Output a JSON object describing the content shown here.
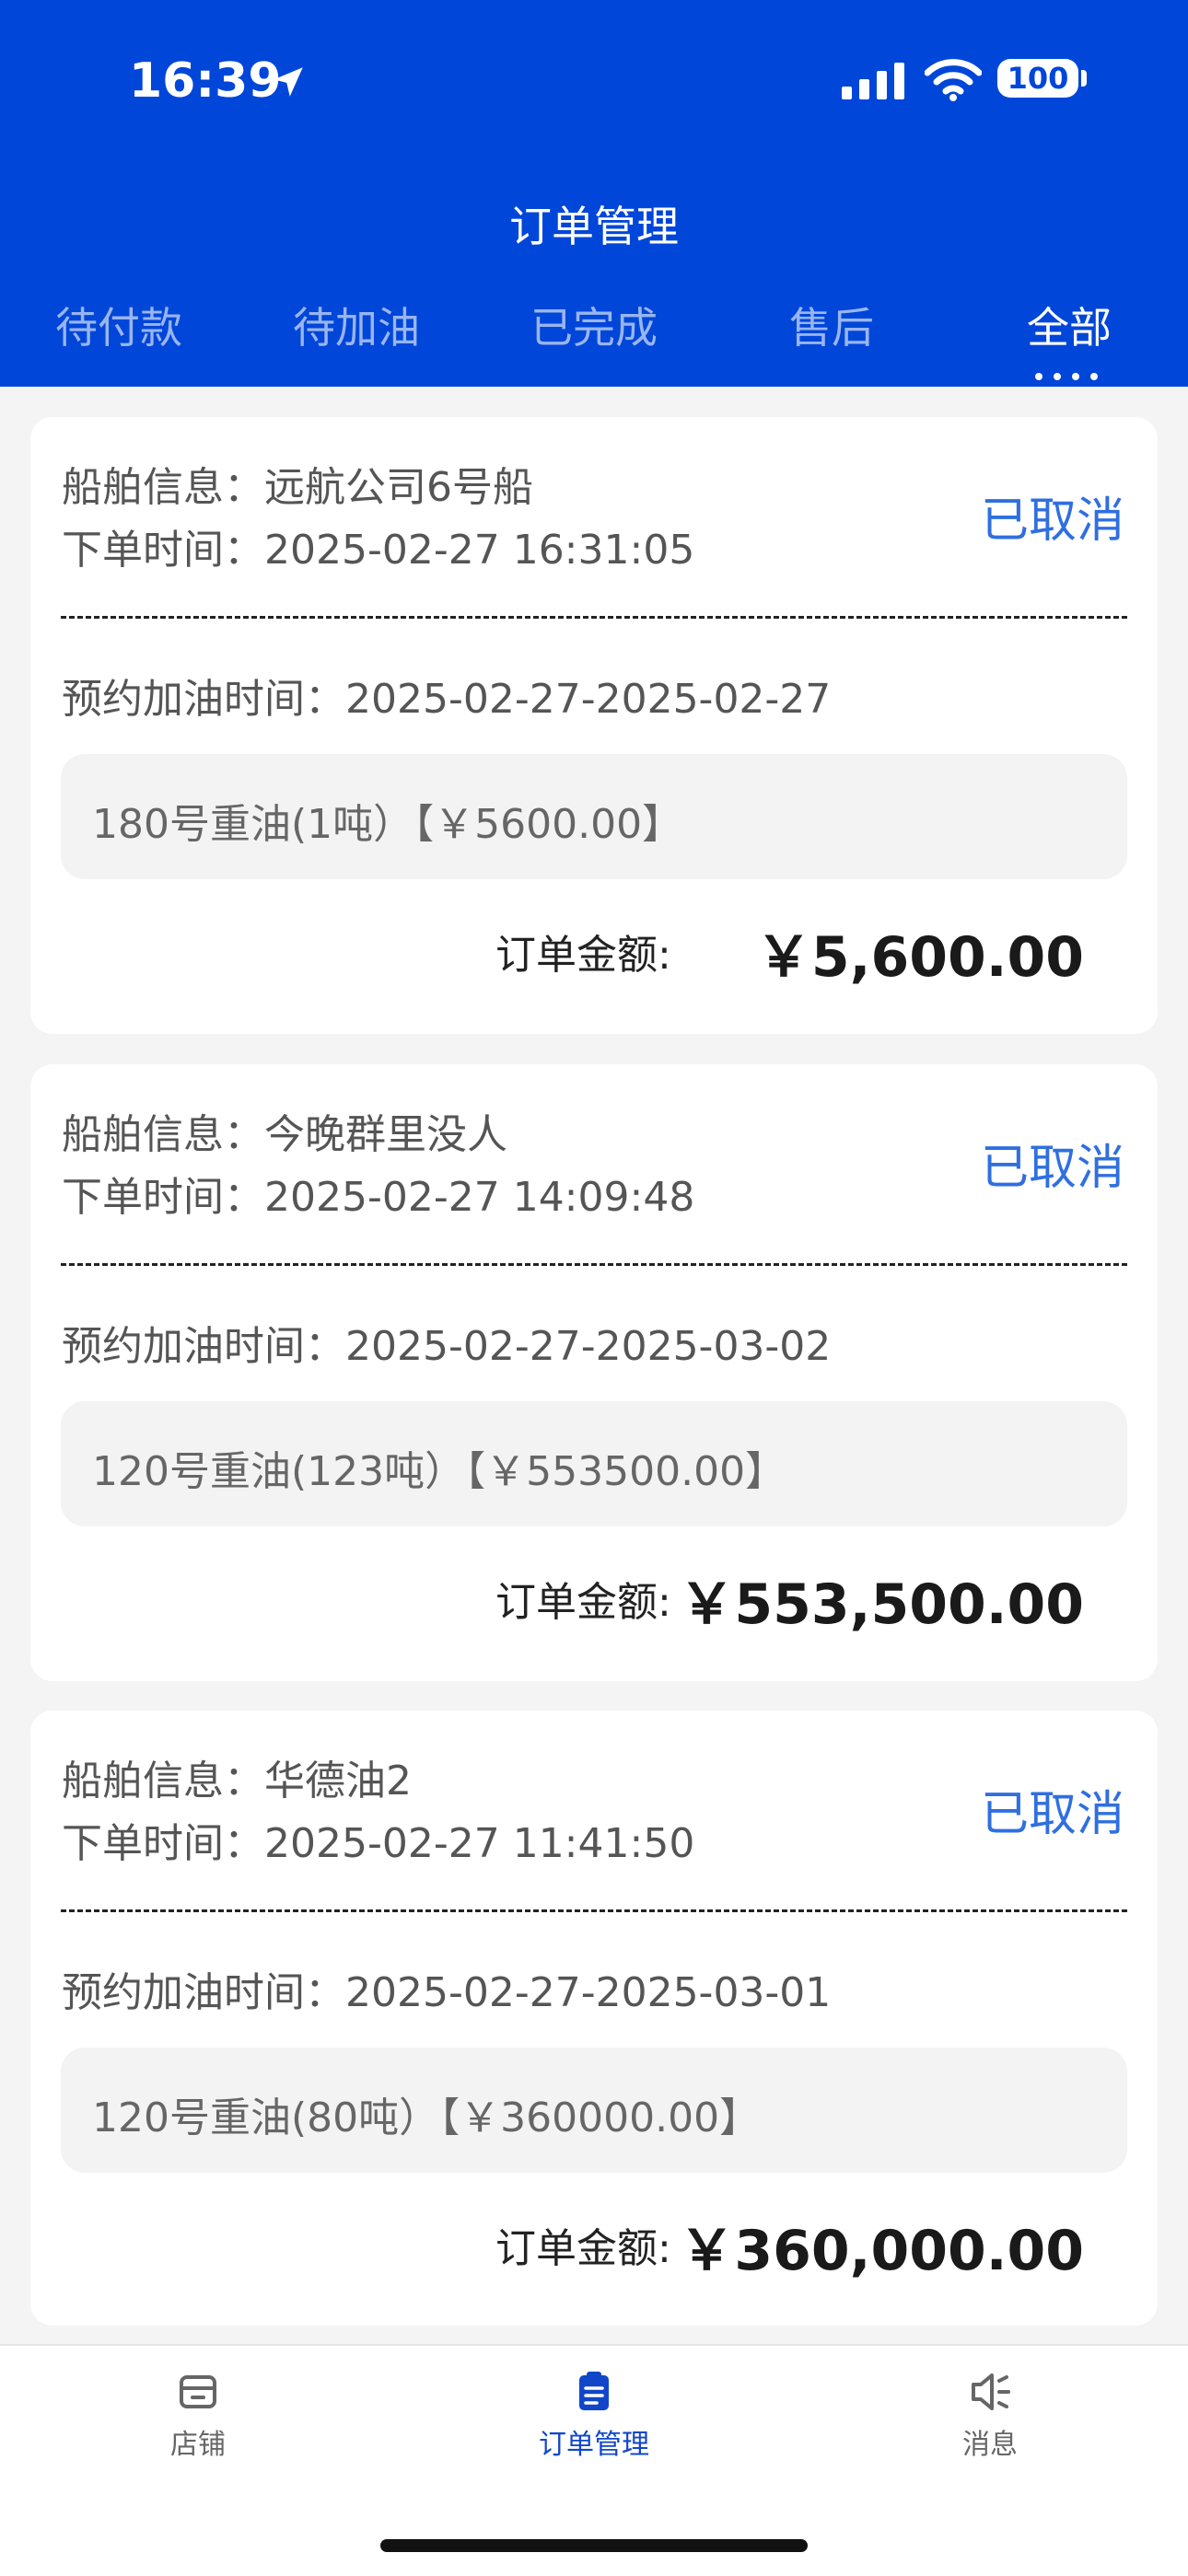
{
  "status_bar": {
    "time": "16:39",
    "battery": "100"
  },
  "page_title": "订单管理",
  "tabs": [
    {
      "label": "待付款"
    },
    {
      "label": "待加油"
    },
    {
      "label": "已完成"
    },
    {
      "label": "售后"
    },
    {
      "label": "全部",
      "active": true
    }
  ],
  "orders": [
    {
      "ship_label": "船舶信息：",
      "ship_name": "远航公司6号船",
      "time_label": "下单时间：",
      "order_time": "2025-02-27 16:31:05",
      "status": "已取消",
      "appointment_label": "预约加油时间：",
      "appointment": "2025-02-27-2025-02-27",
      "product": "180号重油(1吨）【￥5600.00】",
      "amount_label": "订单金额:",
      "amount": "￥5,600.00"
    },
    {
      "ship_label": "船舶信息：",
      "ship_name": "今晚群里没人",
      "time_label": "下单时间：",
      "order_time": "2025-02-27 14:09:48",
      "status": "已取消",
      "appointment_label": "预约加油时间：",
      "appointment": "2025-02-27-2025-03-02",
      "product": "120号重油(123吨）【￥553500.00】",
      "amount_label": "订单金额:",
      "amount": "￥553,500.00"
    },
    {
      "ship_label": "船舶信息：",
      "ship_name": "华德油2",
      "time_label": "下单时间：",
      "order_time": "2025-02-27 11:41:50",
      "status": "已取消",
      "appointment_label": "预约加油时间：",
      "appointment": "2025-02-27-2025-03-01",
      "product": "120号重油(80吨）【￥360000.00】",
      "amount_label": "订单金额:",
      "amount": "￥360,000.00"
    }
  ],
  "bottom_nav": [
    {
      "label": "店铺",
      "icon": "store-icon"
    },
    {
      "label": "订单管理",
      "icon": "clipboard-icon",
      "active": true
    },
    {
      "label": "消息",
      "icon": "speaker-icon"
    }
  ],
  "colors": {
    "header_bg": "#0046d9",
    "status_blue": "#2f6fe0",
    "nav_active": "#1146c9"
  }
}
